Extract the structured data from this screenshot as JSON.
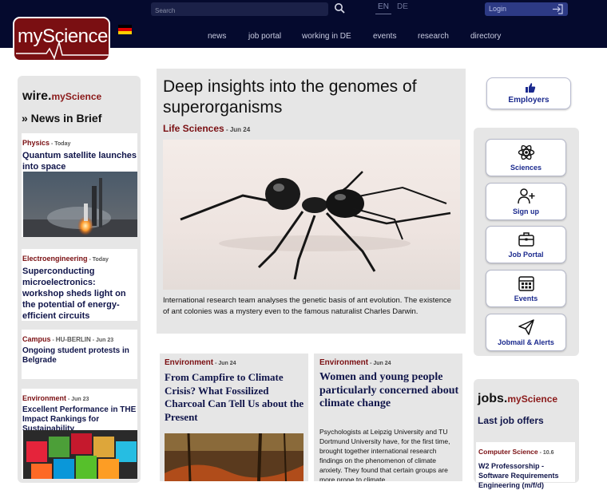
{
  "header": {
    "logo_text": "myScience",
    "search_placeholder": "Search",
    "languages": [
      "EN",
      "DE"
    ],
    "login_label": "Login",
    "nav": [
      "news",
      "job portal",
      "working in DE",
      "events",
      "research",
      "directory"
    ]
  },
  "wire": {
    "brand_wire": "wire.",
    "brand_my": "myScience",
    "section": "» News in Brief",
    "items": [
      {
        "category": "Physics",
        "date": "Today",
        "title": "Quantum satellite launches into space"
      },
      {
        "category": "Electroengineering",
        "date": "Today",
        "title": "Superconducting microelectronics: workshop sheds light on the potential of energy-efficient circuits"
      },
      {
        "category": "Campus",
        "sub": "HU-BERLIN",
        "date": "Jun 23",
        "title": "Ongoing student protests in Belgrade"
      },
      {
        "category": "Environment",
        "date": "Jun 23",
        "title": "Excellent Performance in THE Impact Rankings for Sustainability"
      }
    ]
  },
  "feature": {
    "title": "Deep insights into the genomes of superorganisms",
    "category": "Life Sciences",
    "date": "Jun 24",
    "text": "International research team analyses the genetic basis of ant evolution. The existence of ant colonies was a mystery even to the famous naturalist Charles Darwin."
  },
  "articles": [
    {
      "category": "Environment",
      "date": "Jun 24",
      "title": "From Campfire to Climate Crisis? What Fossilized Charcoal Can Tell Us about the Present"
    },
    {
      "category": "Environment",
      "date": "Jun 24",
      "title": "Women and young people particularly concerned about climate change",
      "text": "Psychologists at Leipzig University and TU Dortmund University have, for the first time, brought together international research findings on the phenomenon of climate anxiety. They found that certain groups are more prone to climate"
    }
  ],
  "right": {
    "employers": "Employers",
    "buttons": [
      "Sciences",
      "Sign up",
      "Job Portal",
      "Events",
      "Jobmail & Alerts"
    ],
    "jobs_brand": "jobs.",
    "jobs_my": "myScience",
    "last_jobs": "Last job offers",
    "job": {
      "category": "Computer Science",
      "date": "10.6",
      "title": "W2 Professorship - Software Requirements Engineering (m/f/d)"
    }
  },
  "colors": {
    "header_bg": "#050a2e",
    "logo_bg": "#7a0f12",
    "accent_blue": "#1b2a8e",
    "category_red": "#7a0f12"
  }
}
